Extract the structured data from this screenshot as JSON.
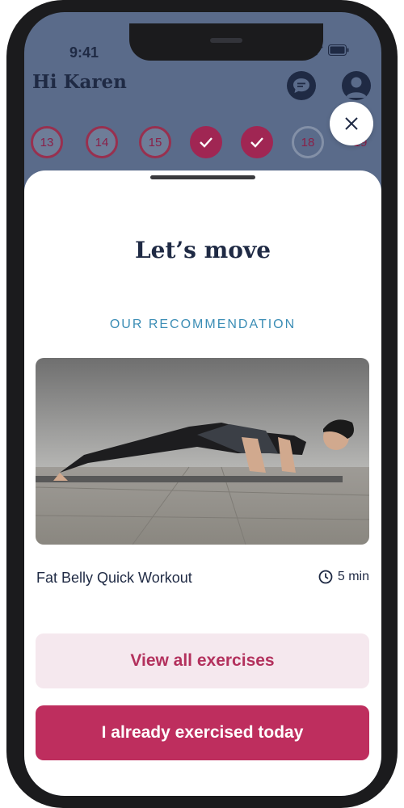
{
  "status_bar": {
    "time": "9:41"
  },
  "header": {
    "greeting": "Hi Karen"
  },
  "day_strip": {
    "days": [
      {
        "label": "13",
        "state": "in-progress",
        "progress": 0.6
      },
      {
        "label": "14",
        "state": "in-progress",
        "progress": 0.4
      },
      {
        "label": "15",
        "state": "in-progress",
        "progress": 0.7
      },
      {
        "label": "",
        "state": "done"
      },
      {
        "label": "",
        "state": "done"
      },
      {
        "label": "18",
        "state": "upcoming"
      },
      {
        "label": "19",
        "state": "upcoming"
      }
    ]
  },
  "sheet": {
    "title": "Let’s move",
    "subtitle": "OUR RECOMMENDATION",
    "workout": {
      "title": "Fat Belly Quick Workout",
      "duration": "5 min"
    },
    "buttons": {
      "secondary": "View all exercises",
      "primary": "I already exercised today"
    }
  },
  "colors": {
    "accent": "#be2e5e",
    "accent_light": "#f5e8ee",
    "navy": "#1f2a44",
    "subtitle_blue": "#3b8db5"
  },
  "icons": {
    "close": "close-icon",
    "chat": "chat-icon",
    "profile": "profile-icon",
    "clock": "clock-icon",
    "check": "check-icon"
  }
}
